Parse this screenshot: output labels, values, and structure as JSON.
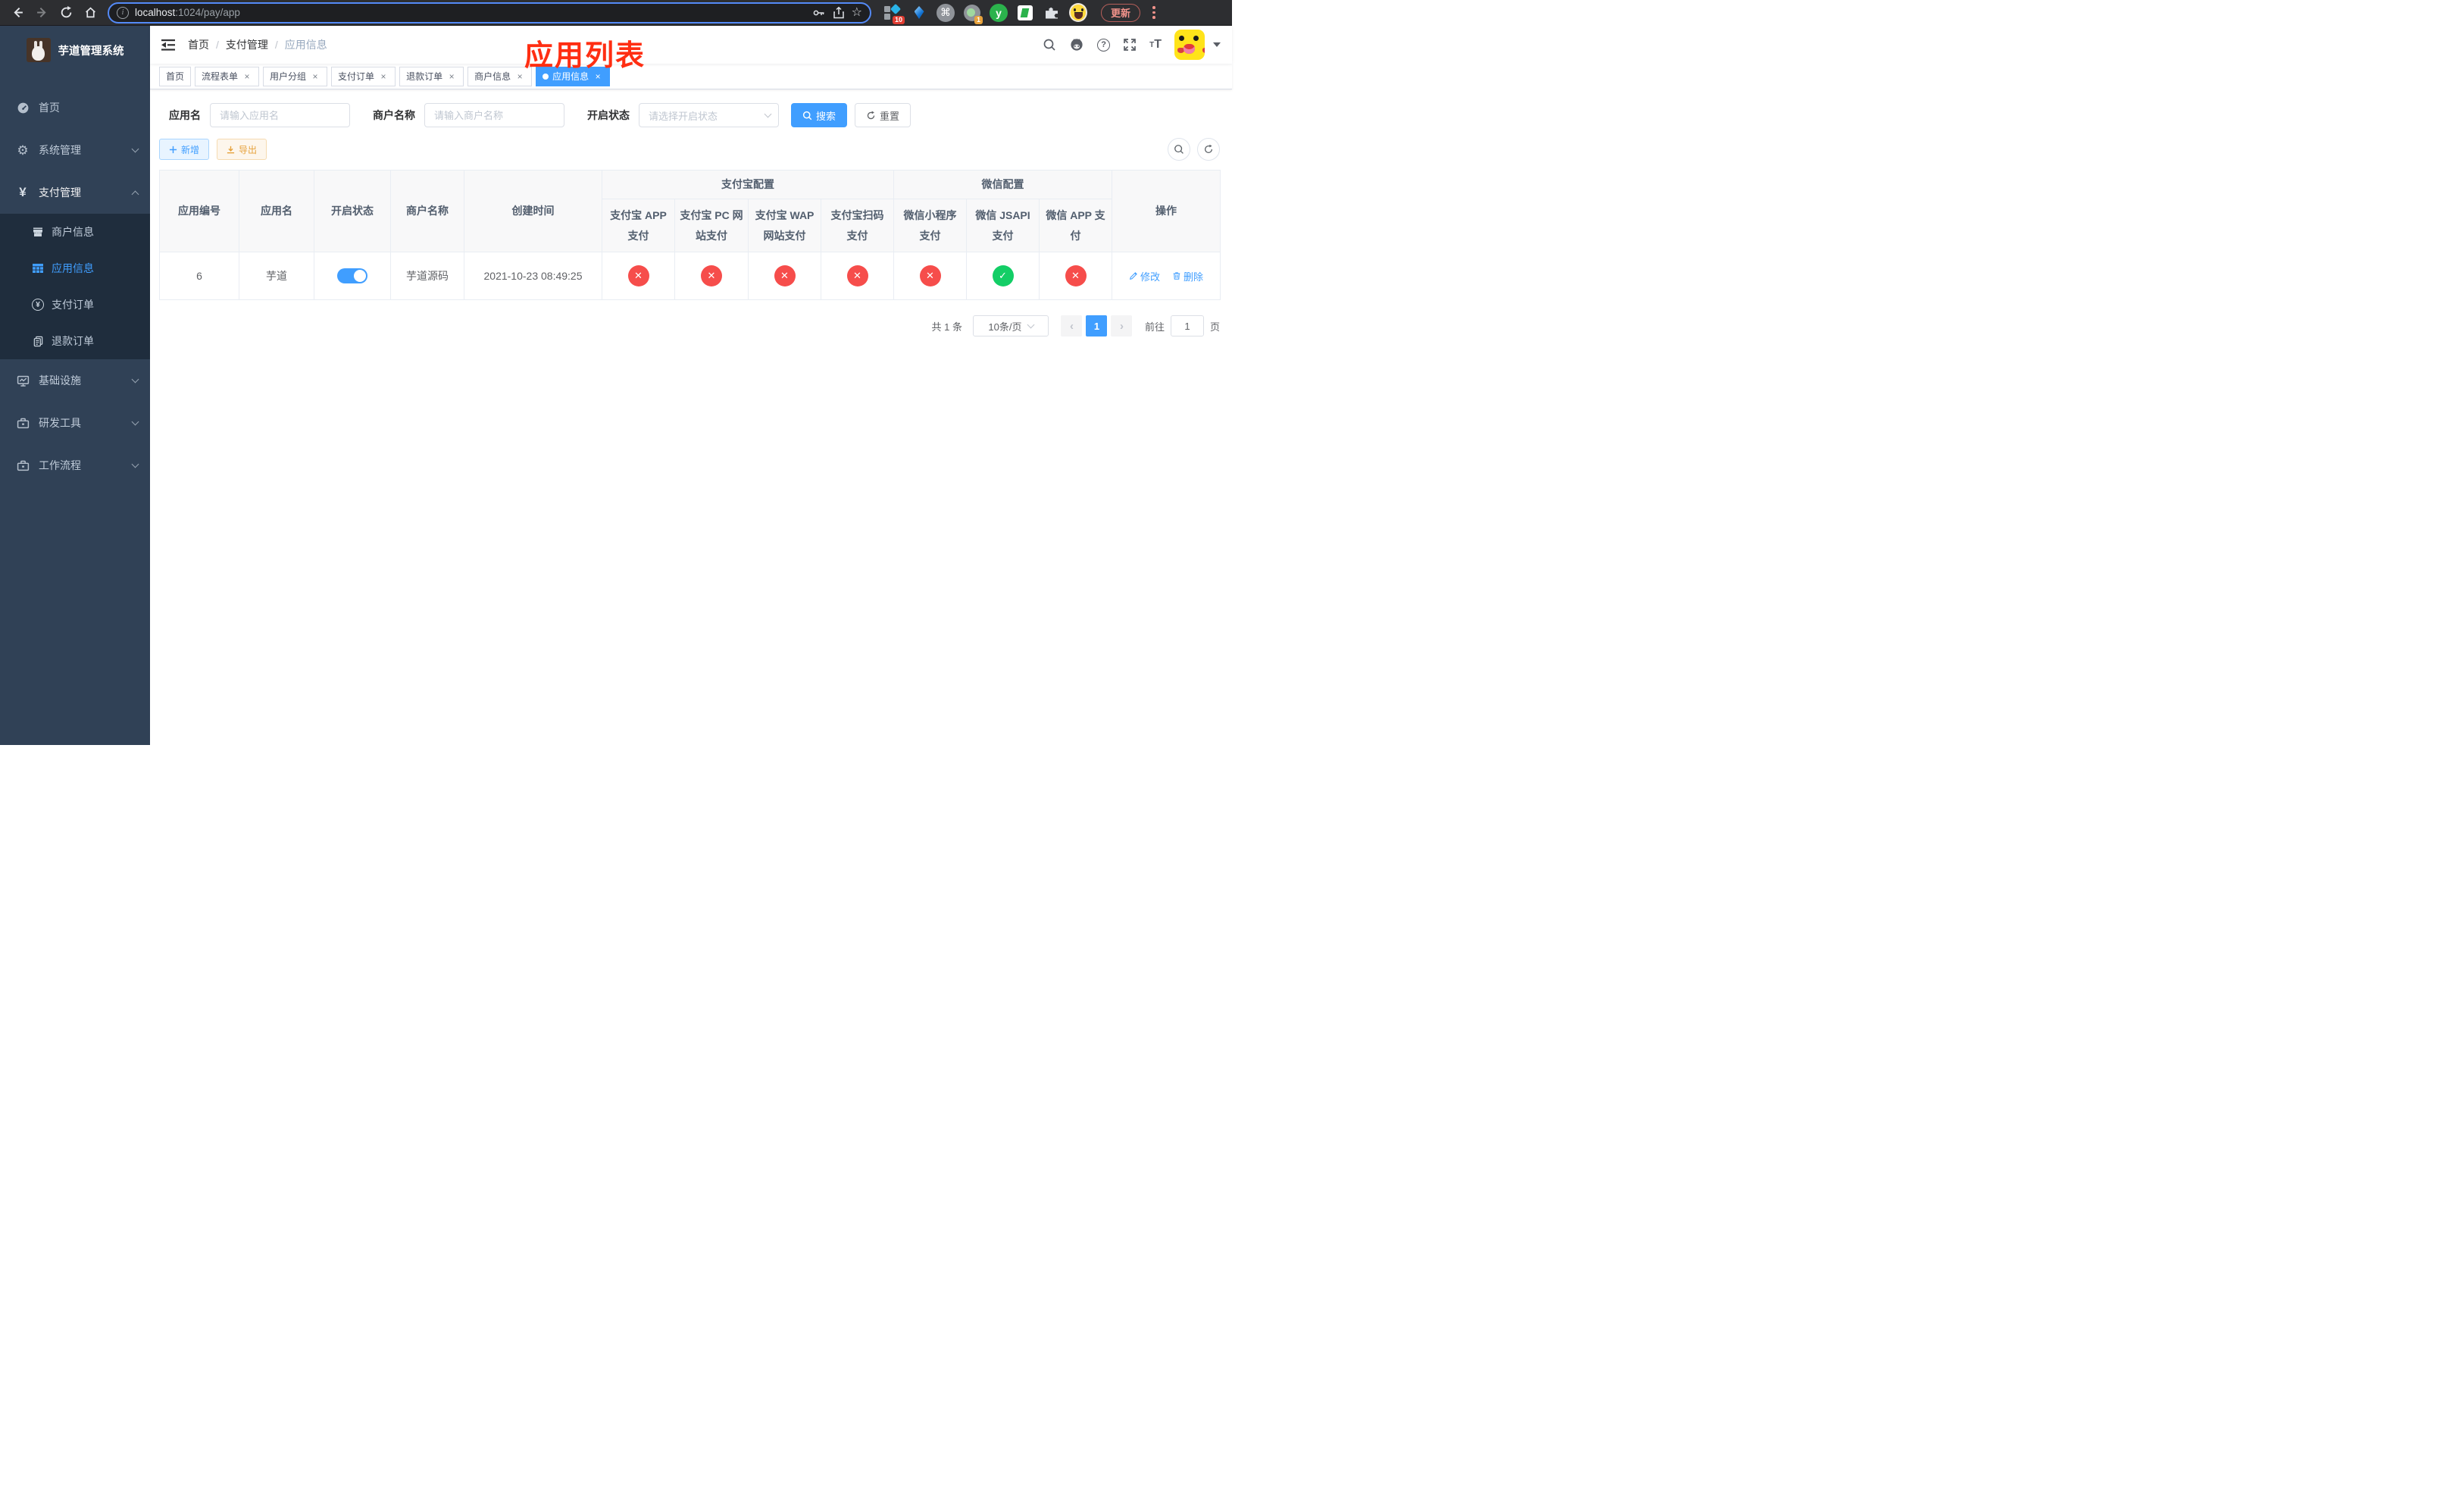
{
  "browser": {
    "url_host": "localhost",
    "url_path": ":1024/pay/app",
    "update_label": "更新",
    "ext_badge_a": "10",
    "ext_badge_b": "1"
  },
  "sidebar": {
    "title": "芋道管理系统",
    "menu": [
      {
        "label": "首页"
      },
      {
        "label": "系统管理"
      },
      {
        "label": "支付管理"
      },
      {
        "label": "基础设施"
      },
      {
        "label": "研发工具"
      },
      {
        "label": "工作流程"
      }
    ],
    "submenu": [
      {
        "label": "商户信息"
      },
      {
        "label": "应用信息"
      },
      {
        "label": "支付订单"
      },
      {
        "label": "退款订单"
      }
    ]
  },
  "navbar": {
    "breadcrumb": [
      "首页",
      "支付管理",
      "应用信息"
    ]
  },
  "overlay_title": "应用列表",
  "tabs": [
    {
      "label": "首页"
    },
    {
      "label": "流程表单"
    },
    {
      "label": "用户分组"
    },
    {
      "label": "支付订单"
    },
    {
      "label": "退款订单"
    },
    {
      "label": "商户信息"
    },
    {
      "label": "应用信息"
    }
  ],
  "filters": {
    "app_name_label": "应用名",
    "app_name_placeholder": "请输入应用名",
    "merchant_label": "商户名称",
    "merchant_placeholder": "请输入商户名称",
    "status_label": "开启状态",
    "status_placeholder": "请选择开启状态",
    "search_label": "搜索",
    "reset_label": "重置"
  },
  "toolbar": {
    "add_label": "新增",
    "export_label": "导出"
  },
  "table": {
    "groups": {
      "alipay": "支付宝配置",
      "wechat": "微信配置"
    },
    "columns": [
      "应用编号",
      "应用名",
      "开启状态",
      "商户名称",
      "创建时间",
      "支付宝 APP 支付",
      "支付宝 PC 网站支付",
      "支付宝 WAP 网站支付",
      "支付宝扫码支付",
      "微信小程序支付",
      "微信 JSAPI 支付",
      "微信 APP 支付",
      "操作"
    ],
    "rows": [
      {
        "app_id": "6",
        "app_name": "芋道",
        "enabled": true,
        "merchant_name": "芋道源码",
        "create_time": "2021-10-23 08:49:25",
        "pay_status": [
          "cross",
          "cross",
          "cross",
          "cross",
          "cross",
          "check",
          "cross"
        ],
        "edit_label": "修改",
        "delete_label": "删除"
      }
    ]
  },
  "pagination": {
    "total_text": "共 1 条",
    "page_size_text": "10条/页",
    "current_page": "1",
    "goto_prefix": "前往",
    "goto_value": "1",
    "goto_suffix": "页"
  },
  "colors": {
    "primary": "#409EFF",
    "success": "#13ce66",
    "danger": "#f64d4b",
    "warning": "#e6a23c",
    "sidebar_bg": "#304156",
    "submenu_bg": "#1f2d3d",
    "annotation_red": "#ff2e12"
  }
}
